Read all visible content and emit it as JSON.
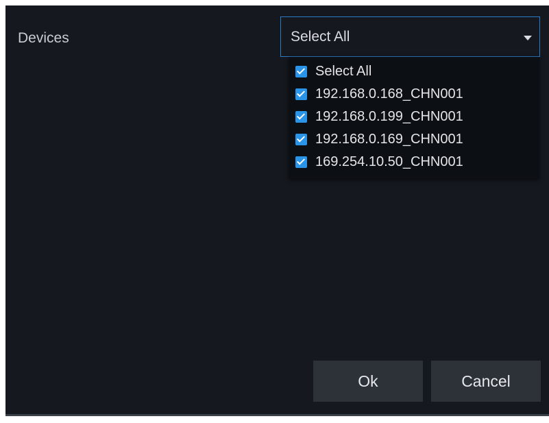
{
  "form": {
    "devices_label": "Devices",
    "select_value": "Select All"
  },
  "dropdown": {
    "options": [
      {
        "label": "Select All",
        "checked": true
      },
      {
        "label": "192.168.0.168_CHN001",
        "checked": true
      },
      {
        "label": "192.168.0.199_CHN001",
        "checked": true
      },
      {
        "label": "192.168.0.169_CHN001",
        "checked": true
      },
      {
        "label": "169.254.10.50_CHN001",
        "checked": true
      }
    ]
  },
  "buttons": {
    "ok_label": "Ok",
    "cancel_label": "Cancel"
  },
  "colors": {
    "background": "#15191f",
    "accent": "#2a94e8",
    "select_border": "#2a7bc8",
    "button": "#2d3138"
  },
  "icons": {
    "caret": "caret-down-icon",
    "checkbox": "checkmark-icon"
  }
}
